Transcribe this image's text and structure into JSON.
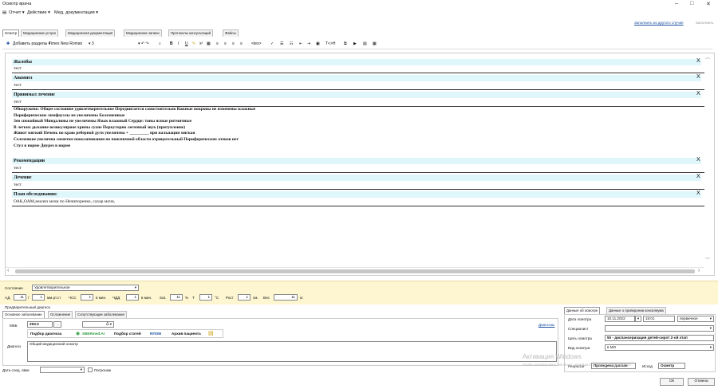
{
  "window": {
    "title": "Осмотр врача",
    "minimize_label": "–",
    "maximize_label": "□",
    "close_label": "✕"
  },
  "menu": {
    "items": [
      "Отчет ▾",
      "Действие ▾",
      "Мед. документация ▾"
    ]
  },
  "top_links": {
    "fill_from_other": "Заполнить из другого случая",
    "fill": "Заполнить"
  },
  "tabs": [
    "Осмотр",
    "Медицинские услуги",
    "Медицинская документация",
    "Медицинские записи",
    "Протоколы консультаций",
    "Файлы"
  ],
  "toolbar": {
    "add_sections": "Добавить разделы ▾",
    "font": "Times New Roman",
    "size": "3",
    "tags": "<tex>",
    "formula": "Т<>Н"
  },
  "sections": [
    {
      "title": "Жалобы",
      "text": "тест"
    },
    {
      "title": "Анамнез",
      "text": "тест"
    },
    {
      "title": "Принимал лечение",
      "text": "тест"
    },
    {
      "title": "Рекомендации",
      "text": "тест"
    },
    {
      "title": "Лечение",
      "text": "тест"
    },
    {
      "title": "План обследования:",
      "text": "ОАК,ОАМ,анализ мочи по Нечипоренко, сахар мочи,"
    }
  ],
  "section_close": "X",
  "exam_lines": [
    "Обнаружено:  Общее состояние удовлетворительное   Передвигается самостоятельно   Кожные покровы не изменены влажные",
    "Периферические лимфоузлы     не увеличены     Болезненные",
    "Зев  спокойный   Миндалины не увеличены   Язык влажный   Сердце: тоны ясные ритмичные",
    "В легких дыхание везикулярное    хрипы сухие      Перкуторно легочный звук (притупление)",
    "Живот      мягкий   Печень по краю реберной дуги увеличена + _________     при пальпации мягкая",
    "Селезенкие увелична  симптом поколачивания по поясничной области     отрицательный                   Периферических отеков нет",
    "Стул в норме   Диурез в норме"
  ],
  "status": {
    "state_label": "Состояние",
    "state_value": "Удовлетворительное",
    "ad_label": "АД",
    "ad_sys": "11",
    "ad_dia": "1",
    "ad_unit": "мм.рт.ст",
    "chss_label": "ЧСС",
    "chss": "1",
    "chss_unit": "в мин.",
    "chdd_label": "ЧДД",
    "chdd": "1",
    "chdd_unit": "в мин.",
    "sat_label": "Sat.",
    "sat": "11",
    "sat_unit": "%",
    "t_label": "Т",
    "t": "1",
    "t_unit": "°С",
    "height_label": "Рост",
    "height": "1",
    "height_unit": "см.",
    "weight_label": "Вес",
    "weight": "11",
    "weight_unit": "кг."
  },
  "diagnosis": {
    "title": "Предварительный диагноз",
    "tabs": [
      "Основное заболевание",
      "Осложнение",
      "Сопутствующие заболевания"
    ],
    "mkb_label": "МКБ",
    "mkb_value": "Z00.0",
    "diagnoses_link": "Диагнозы",
    "pick_diag": "Подбор диагноза",
    "sber": "SBERmed.AI",
    "pick_articles": "Подбор статей",
    "rgom": "RПОМ",
    "archive": "Архив пациента",
    "diag_label": "Диагноз",
    "diag_value": "Общий медицинский осмотр"
  },
  "next_visit": {
    "label": "Дата след. явки",
    "patronage": "Патронаж"
  },
  "right_panel": {
    "tabs": [
      "Данные об осмотре",
      "Данные о проведении консилиума"
    ],
    "date_label": "Дата осмотра",
    "date_value": "10.11.2022",
    "time_value": "15:01",
    "visit_type": "первичное",
    "specialist_label": "Специалист",
    "purpose_label": "Цель осмотра",
    "purpose_value": "50 - диспансеризация детей-сирот 2-ой этап",
    "kind_label": "Вид осмотра",
    "kind_value": "в МО",
    "result_label": "Результат",
    "result_value": "Проведена диспан",
    "outcome_label": "Исход",
    "outcome_value": "Осмотр"
  },
  "buttons": {
    "ok": "Ok",
    "cancel": "Отмена"
  },
  "watermark": {
    "line1": "Активация Windows",
    "line2": "Чтобы активировать Windows, перейдите в раздел «Параметры»."
  }
}
